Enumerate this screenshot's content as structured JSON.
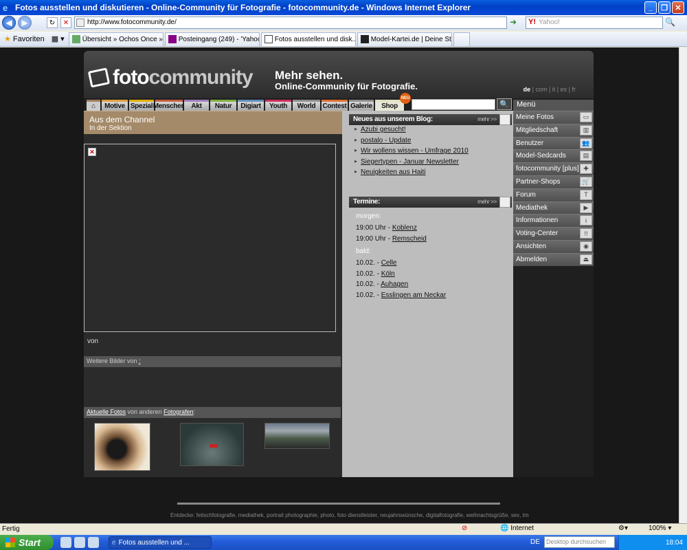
{
  "window": {
    "title": "Fotos ausstellen und diskutieren - Online-Community für Fotografie - fotocommunity.de - Windows Internet Explorer"
  },
  "toolbar": {
    "url": "http://www.fotocommunity.de/",
    "search_placeholder": "Yahoo!",
    "search_engine": "Y!"
  },
  "favbar": {
    "favorites_label": "Favoriten",
    "tabs": [
      {
        "label": "Übersicht » Ochos Once » Ha..."
      },
      {
        "label": "Posteingang (249) - 'Yahoo! ..."
      },
      {
        "label": "Fotos ausstellen und disk..."
      },
      {
        "label": "Model-Kartei.de | Deine Start..."
      }
    ]
  },
  "site": {
    "logo": {
      "part1": "foto",
      "part2": "community"
    },
    "slogan1": "Mehr sehen.",
    "slogan2": "Online-Community für Fotografie.",
    "langs": [
      "de",
      "com",
      "it",
      "es",
      "fr"
    ],
    "nav": [
      {
        "label": "Motive",
        "color": "#e0a040"
      },
      {
        "label": "Spezial",
        "color": "#e0b000"
      },
      {
        "label": "Menschen",
        "color": "#c86040"
      },
      {
        "label": "Akt",
        "color": "#a080c0"
      },
      {
        "label": "Natur",
        "color": "#80b040"
      },
      {
        "label": "Digiart",
        "color": "#6090c0"
      },
      {
        "label": "Youth",
        "color": "#d03060"
      },
      {
        "label": "World",
        "color": "#909090"
      },
      {
        "label": "Contest",
        "color": "#e07030"
      },
      {
        "label": "Galerie",
        "color": "#909090"
      },
      {
        "label": "Shop",
        "color": "#e0e0c0"
      }
    ],
    "shop_badge": "NEU",
    "channel": {
      "title": "Aus dem Channel",
      "subtitle": "In der Sektion"
    },
    "von": "von",
    "weitere": {
      "prefix": "Weitere Bilder von",
      "link": ":"
    },
    "aktuelle": {
      "link1": "Aktuelle Fotos",
      "mid": " von anderen ",
      "link2": "Fotografen",
      "suffix": ":"
    },
    "blog": {
      "title": "Neues aus unserem Blog:",
      "mehr": "mehr >>",
      "items": [
        "Azubi gesucht!",
        "postalo - Update",
        "Wir wollens wissen - Umfrage 2010",
        "Siegertypen - Januar Newsletter",
        "Neuigkeiten aus Haiti"
      ]
    },
    "termine": {
      "title": "Termine:",
      "mehr": "mehr >>",
      "morgen_label": "morgen:",
      "morgen": [
        {
          "time": "19:00 Uhr - ",
          "place": "Koblenz"
        },
        {
          "time": "19:00 Uhr - ",
          "place": "Remscheid"
        }
      ],
      "bald_label": "bald:",
      "bald": [
        {
          "time": "10.02. - ",
          "place": "Celle"
        },
        {
          "time": "10.02. - ",
          "place": "Köln"
        },
        {
          "time": "10.02. - ",
          "place": "Auhagen"
        },
        {
          "time": "10.02. - ",
          "place": "Esslingen am Neckar"
        }
      ]
    },
    "menu": {
      "title": "Menü",
      "items": [
        {
          "label": "Meine Fotos",
          "icon": "photos-icon"
        },
        {
          "label": "Mitgliedschaft",
          "icon": "membership-icon"
        },
        {
          "label": "Benutzer",
          "icon": "users-icon"
        },
        {
          "label": "Model-Sedcards",
          "icon": "sedcard-icon"
        },
        {
          "label": "fotocommunity [plus]",
          "icon": "plus-icon"
        },
        {
          "label": "Partner-Shops",
          "icon": "cart-icon"
        },
        {
          "label": "Forum",
          "icon": "forum-icon"
        },
        {
          "label": "Mediathek",
          "icon": "media-icon"
        },
        {
          "label": "Informationen",
          "icon": "info-icon"
        },
        {
          "label": "Voting-Center",
          "icon": "voting-icon"
        },
        {
          "label": "Ansichten",
          "icon": "eye-icon"
        },
        {
          "label": "Abmelden",
          "icon": "logout-icon"
        }
      ]
    },
    "footer": "Entdecke: fetischfotografie, mediathek, portrait photographie, photo, foto dienstleister, neujahrswünsche, digitalfotografie, weihnachtsgrüße, sex, tm"
  },
  "status": {
    "text": "Fertig",
    "zone": "Internet",
    "zoom": "100%"
  },
  "taskbar": {
    "start": "Start",
    "task": "Fotos ausstellen und ...",
    "desksearch": "Desktop durchsuchen",
    "lang": "DE",
    "clock": "18:04"
  }
}
